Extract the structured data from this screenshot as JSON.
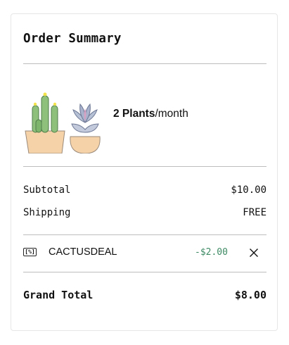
{
  "summary": {
    "title": "Order Summary",
    "plan": {
      "count_label": "2 Plants",
      "frequency": "/month"
    },
    "subtotal": {
      "label": "Subtotal",
      "value": "$10.00"
    },
    "shipping": {
      "label": "Shipping",
      "value": "FREE"
    },
    "promo": {
      "badge": "[%]",
      "code": "CACTUSDEAL",
      "discount": "-$2.00",
      "remove_icon": "close-icon"
    },
    "grand_total": {
      "label": "Grand Total",
      "value": "$8.00"
    }
  },
  "colors": {
    "discount": "#3d8a64",
    "divider": "#bdbdbd",
    "pot": "#f6d2a8",
    "plant": "#8ec07c"
  }
}
